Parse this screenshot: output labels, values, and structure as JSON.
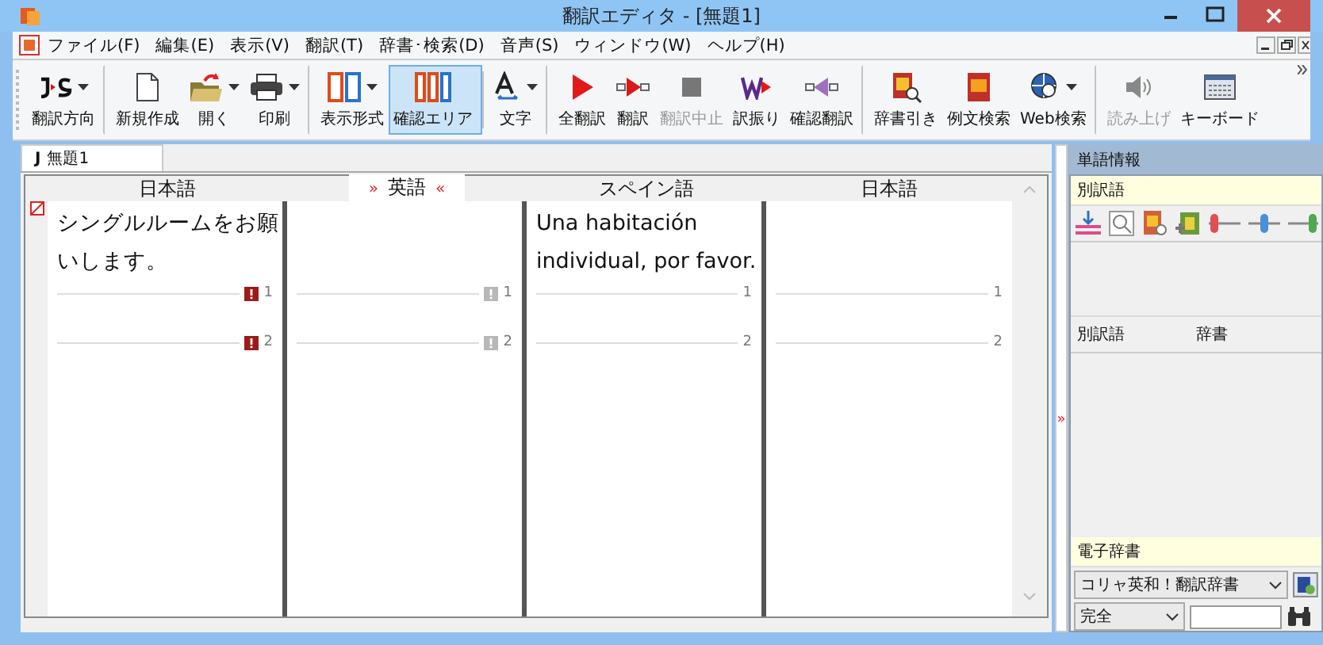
{
  "window": {
    "title": "翻訳エディタ - [無題1]"
  },
  "menu": [
    "ファイル(F)",
    "編集(E)",
    "表示(V)",
    "翻訳(T)",
    "辞書･検索(D)",
    "音声(S)",
    "ウィンドウ(W)",
    "ヘルプ(H)"
  ],
  "toolbar": [
    {
      "label": "翻訳方向",
      "dropdown": true,
      "disabled": false,
      "selected": false,
      "separator_after": true
    },
    {
      "label": "新規作成",
      "dropdown": false,
      "disabled": false,
      "selected": false,
      "separator_after": false
    },
    {
      "label": "開く",
      "dropdown": true,
      "disabled": false,
      "selected": false,
      "separator_after": false
    },
    {
      "label": "印刷",
      "dropdown": true,
      "disabled": false,
      "selected": false,
      "separator_after": true
    },
    {
      "label": "表示形式",
      "dropdown": true,
      "disabled": false,
      "selected": false,
      "separator_after": false
    },
    {
      "label": "確認エリア",
      "dropdown": false,
      "disabled": false,
      "selected": true,
      "separator_after": true
    },
    {
      "label": "文字",
      "dropdown": true,
      "disabled": false,
      "selected": false,
      "separator_after": true
    },
    {
      "label": "全翻訳",
      "dropdown": false,
      "disabled": false,
      "selected": false,
      "separator_after": false
    },
    {
      "label": "翻訳",
      "dropdown": false,
      "disabled": false,
      "selected": false,
      "separator_after": false
    },
    {
      "label": "翻訳中止",
      "dropdown": false,
      "disabled": true,
      "selected": false,
      "separator_after": false
    },
    {
      "label": "訳振り",
      "dropdown": false,
      "disabled": false,
      "selected": false,
      "separator_after": false
    },
    {
      "label": "確認翻訳",
      "dropdown": false,
      "disabled": false,
      "selected": false,
      "separator_after": true
    },
    {
      "label": "辞書引き",
      "dropdown": false,
      "disabled": false,
      "selected": false,
      "separator_after": false
    },
    {
      "label": "例文検索",
      "dropdown": false,
      "disabled": false,
      "selected": false,
      "separator_after": false
    },
    {
      "label": "Web検索",
      "dropdown": true,
      "disabled": false,
      "selected": false,
      "separator_after": true
    },
    {
      "label": "読み上げ",
      "dropdown": false,
      "disabled": true,
      "selected": false,
      "separator_after": false
    },
    {
      "label": "キーボード",
      "dropdown": false,
      "disabled": false,
      "selected": false,
      "separator_after": false
    }
  ],
  "document_tab": {
    "letter": "J",
    "label": "無題1",
    "selected": true
  },
  "columns": [
    {
      "language": "日本語",
      "selected": false,
      "lines": [
        "シングルルームをお願",
        "いします。"
      ],
      "flag": true,
      "flag_active": true,
      "row_numbers": [
        "1",
        "2"
      ]
    },
    {
      "language": "英語",
      "selected": true,
      "markers": [
        "»",
        "«"
      ],
      "flag": true,
      "flag_active": false,
      "row_numbers": [
        "1",
        "2"
      ]
    },
    {
      "language": "スペイン語",
      "selected": false,
      "lines": [
        "Una habitación",
        "individual, por favor."
      ],
      "flag": false,
      "row_numbers": [
        "1",
        "2"
      ]
    },
    {
      "language": "日本語",
      "selected": false,
      "flag": false,
      "row_numbers": [
        "1",
        "2"
      ]
    }
  ],
  "splitter_glyph": "»",
  "side_panel": {
    "title": "単語情報",
    "alternatives_title": "別訳語",
    "list_columns": [
      "別訳語",
      "辞書"
    ],
    "dictionary_title": "電子辞書",
    "dictionary_select": "コリャ英和！翻訳辞書",
    "match_select": "完全"
  }
}
